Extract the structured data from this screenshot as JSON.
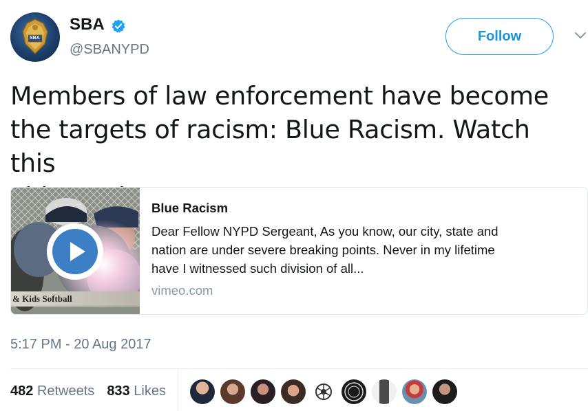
{
  "author": {
    "name": "SBA",
    "handle": "@SBANYPD",
    "verified": true,
    "avatar_badge_text": "SBA"
  },
  "follow_button": {
    "label": "Follow"
  },
  "tweet": {
    "text_lines": [
      "Members of law enforcement have become",
      "the targets of racism: Blue Racism. Watch this",
      "video to learn more:"
    ]
  },
  "card": {
    "title": "Blue Racism",
    "description_lines": [
      "Dear Fellow NYPD Sergeant, As you know, our city, state and",
      "nation are under severe breaking points. Never in my lifetime",
      "have I witnessed such division of all..."
    ],
    "domain": "vimeo.com",
    "thumb_caption": "Kids Softball"
  },
  "timestamp": "5:17 PM - 20 Aug 2017",
  "stats": {
    "retweets_count": "482",
    "retweets_label": "Retweets",
    "likes_count": "833",
    "likes_label": "Likes"
  },
  "colors": {
    "accent": "#1da1f2",
    "muted": "#657786",
    "border": "#e1e8ed"
  },
  "likers": [
    {
      "icon": "user-avatar-icon"
    },
    {
      "icon": "user-avatar-icon"
    },
    {
      "icon": "user-avatar-icon"
    },
    {
      "icon": "user-avatar-icon"
    },
    {
      "icon": "marine-emblem-icon"
    },
    {
      "icon": "logo-avatar-icon"
    },
    {
      "icon": "user-avatar-icon"
    },
    {
      "icon": "user-avatar-icon"
    },
    {
      "icon": "user-avatar-icon"
    }
  ]
}
